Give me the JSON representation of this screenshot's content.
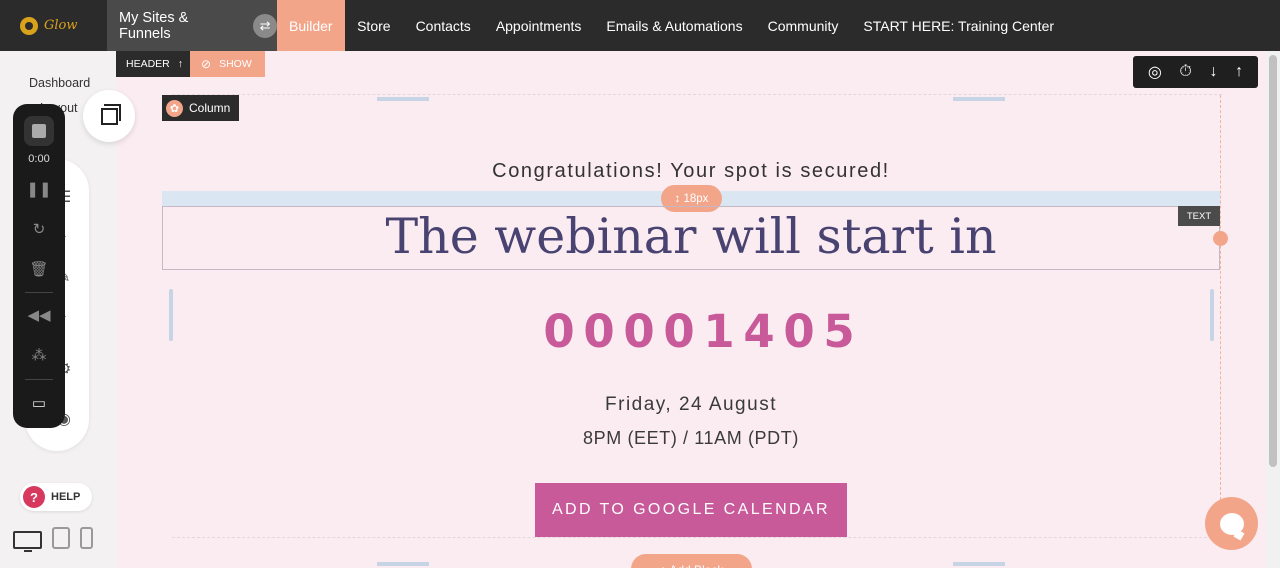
{
  "nav": {
    "logo_text": "Glow",
    "sites_label": "My Sites & Funnels",
    "items": [
      {
        "label": "Builder",
        "active": true
      },
      {
        "label": "Store"
      },
      {
        "label": "Contacts"
      },
      {
        "label": "Appointments"
      },
      {
        "label": "Emails & Automations"
      },
      {
        "label": "Community"
      },
      {
        "label": "START HERE: Training Center"
      }
    ]
  },
  "left": {
    "dashboard": "Dashboard",
    "layout": "Layout",
    "help": "HELP"
  },
  "recorder": {
    "time": "0:00"
  },
  "tags": {
    "header": "HEADER",
    "header_arrow": "↑",
    "show": "SHOW",
    "column": "Column",
    "text": "TEXT",
    "spacing": "↕ 18px",
    "add_block": "+ Add Block"
  },
  "page": {
    "congrats": "Congratulations! Your spot is secured!",
    "headline": "The webinar will start in",
    "countdown": [
      "0",
      "0",
      "0",
      "0",
      "1",
      "4",
      "0",
      "5"
    ],
    "date": "Friday, 24 August",
    "timezones": "8PM (EET) / 11AM (PDT)",
    "cta": "ADD TO GOOGLE CALENDAR"
  },
  "colors": {
    "accent": "#f3a58a",
    "brand_pink": "#c85a9a",
    "headline": "#494371",
    "nav_bg": "#2b2b2b"
  }
}
